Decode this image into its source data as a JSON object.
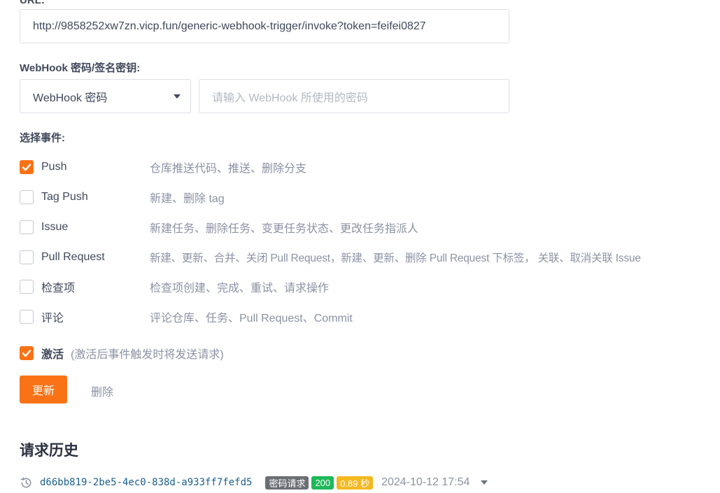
{
  "url_section": {
    "label_cut": "URL:",
    "url_value": "http://9858252xw7zn.vicp.fun/generic-webhook-trigger/invoke?token=feifei0827"
  },
  "secret_section": {
    "label": "WebHook 密码/签名密钥:",
    "select_value": "WebHook 密码",
    "password_placeholder": "请输入 WebHook 所使用的密码"
  },
  "events": {
    "label": "选择事件:",
    "items": [
      {
        "name": "Push",
        "desc": "仓库推送代码、推送、删除分支",
        "checked": true
      },
      {
        "name": "Tag Push",
        "desc": "新建、删除 tag",
        "checked": false
      },
      {
        "name": "Issue",
        "desc": "新建任务、删除任务、变更任务状态、更改任务指派人",
        "checked": false
      },
      {
        "name": "Pull Request",
        "desc": "新建、更新、合并、关闭 Pull Request，新建、更新、删除 Pull Request 下标签， 关联、取消关联 Issue",
        "checked": false
      },
      {
        "name": "检查项",
        "desc": "检查项创建、完成、重试、请求操作",
        "checked": false
      },
      {
        "name": "评论",
        "desc": "评论仓库、任务、Pull Request、Commit",
        "checked": false
      }
    ]
  },
  "activate": {
    "label": "激活",
    "hint": "(激活后事件触发时将发送请求)",
    "checked": true
  },
  "actions": {
    "update_label": "更新",
    "delete_label": "删除"
  },
  "history": {
    "title": "请求历史",
    "entries": [
      {
        "hash": "d66bb819-2be5-4ec0-838d-a933ff7fefd5",
        "type_badge": "密码请求",
        "status_badge": "200",
        "duration_badge": "0.89 秒",
        "timestamp": "2024-10-12 17:54"
      }
    ]
  },
  "colors": {
    "accent": "#f97316",
    "status_success": "#1eb85a",
    "duration": "#f5b81f",
    "type_badge": "#6b6f75"
  },
  "icons": {
    "history": "history-clock-icon",
    "select_caret": "caret-down-icon",
    "expand": "caret-down-icon",
    "check": "checkmark-icon"
  }
}
